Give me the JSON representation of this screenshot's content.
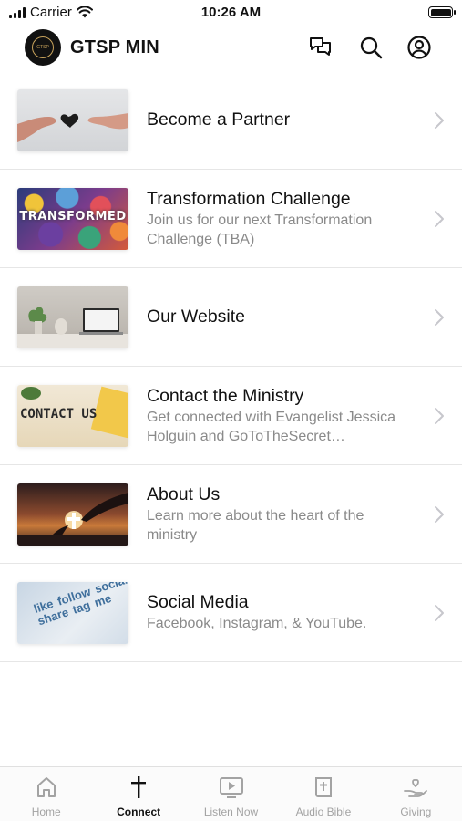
{
  "status_bar": {
    "carrier": "Carrier",
    "time": "10:26 AM"
  },
  "header": {
    "title": "GTSP MIN",
    "logo_text": "GTSP"
  },
  "items": [
    {
      "title": "Become a Partner",
      "subtitle": "",
      "thumb_icon": "hands-heart-image"
    },
    {
      "title": "Transformation Challenge",
      "subtitle": "Join us for our next Transformation Challenge (TBA)",
      "thumb_text": "TRANSFORMED"
    },
    {
      "title": "Our Website",
      "subtitle": "",
      "thumb_icon": "desk-laptop-image"
    },
    {
      "title": "Contact the Ministry",
      "subtitle": "Get connected with Evangelist Jessica Holguin and GoToTheSecret…",
      "thumb_text": "CONTACT US"
    },
    {
      "title": "About Us",
      "subtitle": "Learn more about the heart of the ministry",
      "thumb_icon": "sunset-cross-image"
    },
    {
      "title": "Social Media",
      "subtitle": "Facebook, Instagram, & YouTube.",
      "thumb_text": "like follow social share tag me"
    }
  ],
  "tabs": [
    {
      "label": "Home",
      "icon": "home-icon",
      "active": false
    },
    {
      "label": "Connect",
      "icon": "cross-icon",
      "active": true
    },
    {
      "label": "Listen Now",
      "icon": "play-screen-icon",
      "active": false
    },
    {
      "label": "Audio Bible",
      "icon": "bible-icon",
      "active": false
    },
    {
      "label": "Giving",
      "icon": "giving-hand-icon",
      "active": false
    }
  ],
  "colors": {
    "inactive_tab": "#a3a3a3",
    "active_tab": "#111111",
    "subtitle": "#8a8a8a"
  }
}
